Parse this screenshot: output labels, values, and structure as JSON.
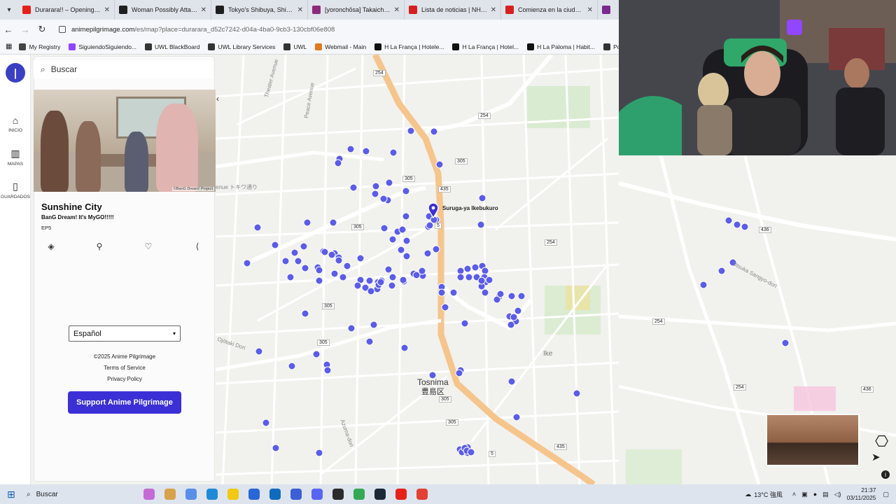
{
  "tabs": [
    {
      "title": "Durarara!! – Opening 1 (H",
      "color": "#e62117"
    },
    {
      "title": "Woman Possibly Attacked",
      "color": "#1f1f1f"
    },
    {
      "title": "Tokyo's Shibuya, Shinjuku",
      "color": "#1f1f1f"
    },
    {
      "title": "[yoronchōsa] Takaichi San",
      "color": "#8e2a7a"
    },
    {
      "title": "Lista de noticias | NHK W",
      "color": "#d61f1f"
    },
    {
      "title": "Comienza en la ciudad de",
      "color": "#d61f1f"
    },
    {
      "title": "P",
      "color": "#7a2a8e"
    }
  ],
  "address": {
    "host": "animepilgrimage.com",
    "path": "/es/map?place=durarara_d52c7242-d04a-4ba0-9cb3-130cbf06e808"
  },
  "bookmarks": [
    {
      "label": "My Registry",
      "color": "#444"
    },
    {
      "label": "SiguiendoSiguiendo...",
      "color": "#9146ff"
    },
    {
      "label": "UWL BlackBoard",
      "color": "#333"
    },
    {
      "label": "UWL Library Services",
      "color": "#333"
    },
    {
      "label": "UWL",
      "color": "#333"
    },
    {
      "label": "Webmail - Main",
      "color": "#e07a1f"
    },
    {
      "label": "H La França | Hotele...",
      "color": "#111"
    },
    {
      "label": "H La França | Hotel...",
      "color": "#111"
    },
    {
      "label": "H La Paloma | Habit...",
      "color": "#111"
    },
    {
      "label": "Posiciones",
      "color": "#333"
    }
  ],
  "rail": {
    "home": "INICIO",
    "maps": "MAPAS",
    "saved": "GUARDADOS"
  },
  "search": {
    "placeholder": "Buscar"
  },
  "place": {
    "credit": "©BanG Dream! Project",
    "title": "Sunshine City",
    "show": "BanG Dream! It's MyGO!!!!!",
    "episode": "EP5"
  },
  "language": {
    "selected": "Español"
  },
  "footer": {
    "copyright": "©2025 Anime Pilgrimage",
    "terms": "Terms of Service",
    "privacy": "Privacy Policy",
    "support": "Support Anime Pilgrimage"
  },
  "map": {
    "selected_marker": "Suruga-ya Ikebukuro",
    "district": "Tosnima",
    "district_jp": "豊島区",
    "road_labels": [
      "254",
      "305",
      "254",
      "435",
      "305",
      "5",
      "305",
      "254",
      "254",
      "305",
      "305",
      "305",
      "435",
      "305",
      "5",
      "436",
      "254",
      "436",
      "254"
    ],
    "street_labels": [
      "Theater Avenue",
      "Peace Avenue",
      "enue トキワ通り",
      "Ojōtaki Dori",
      "Ike",
      "Azuma-dori",
      "Otsuka Sangyo-dori"
    ]
  },
  "taskbar": {
    "search": "Buscar",
    "weather": "13°C 強風",
    "time": "21:37",
    "date": "03/11/2025"
  },
  "colors": {
    "marker": "#5b5ce8",
    "support_button": "#3b2fd6",
    "highway": "#f5c58c"
  }
}
